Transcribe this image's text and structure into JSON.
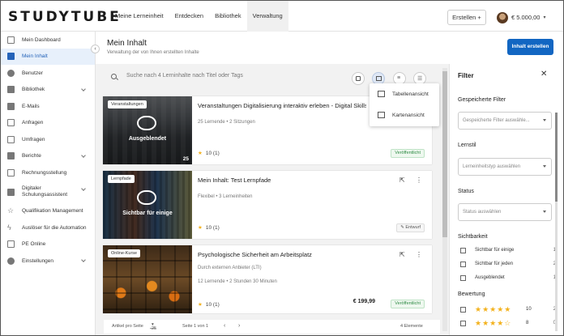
{
  "app": {
    "logo": "STUDYTUBE"
  },
  "topnav": {
    "items": [
      {
        "label": "Meine Lerneinheit",
        "active": false
      },
      {
        "label": "Entdecken",
        "active": false
      },
      {
        "label": "Bibliothek",
        "active": false
      },
      {
        "label": "Verwaltung",
        "active": true
      }
    ],
    "create_label": "Erstellen +",
    "balance": "€ 5.000,00"
  },
  "sidebar": {
    "items": [
      {
        "label": "Mein Dashboard",
        "icon": "dashboard-icon",
        "active": false,
        "expandable": false
      },
      {
        "label": "Mein Inhalt",
        "icon": "content-icon",
        "active": true,
        "expandable": false
      },
      {
        "label": "Benutzer",
        "icon": "user-icon",
        "active": false,
        "expandable": false
      },
      {
        "label": "Bibliothek",
        "icon": "library-icon",
        "active": false,
        "expandable": true
      },
      {
        "label": "E-Mails",
        "icon": "mail-icon",
        "active": false,
        "expandable": false
      },
      {
        "label": "Anfragen",
        "icon": "copy-icon",
        "active": false,
        "expandable": false
      },
      {
        "label": "Umfragen",
        "icon": "survey-icon",
        "active": false,
        "expandable": false
      },
      {
        "label": "Berichte",
        "icon": "report-icon",
        "active": false,
        "expandable": true
      },
      {
        "label": "Rechnungsstellung",
        "icon": "invoice-icon",
        "active": false,
        "expandable": false
      },
      {
        "label": "Digitaler Schulungsassistent",
        "icon": "assistant-icon",
        "active": false,
        "expandable": true
      },
      {
        "label": "Qualifikation Management",
        "icon": "star-icon",
        "active": false,
        "expandable": false
      },
      {
        "label": "Auslöser für die Automation",
        "icon": "bolt-icon",
        "active": false,
        "expandable": false
      },
      {
        "label": "PE Online",
        "icon": "pe-icon",
        "active": false,
        "expandable": false
      },
      {
        "label": "Einstellungen",
        "icon": "gear-icon",
        "active": false,
        "expandable": true
      }
    ]
  },
  "header": {
    "title": "Mein Inhalt",
    "subtitle": "Verwaltung der von Ihnen erstellten Inhalte",
    "primary_button": "Inhalt erstellen"
  },
  "search": {
    "placeholder": "Suche nach 4 Lerninhalte nach Titel oder Tags"
  },
  "view_menu": {
    "items": [
      "Tabellenansicht",
      "Kartenansicht"
    ]
  },
  "cards": [
    {
      "tag": "Veranstaltungen",
      "title": "Veranstaltungen Digitalisierung interaktiv erleben - Digital Skills Camp",
      "meta_lines": [
        "25 Lernende • 2 Sitzungen"
      ],
      "overlay": "Ausgeblendet",
      "count": "25",
      "rating": "10 (1)",
      "price": "",
      "status": "Veröffentlicht",
      "draft": false,
      "actions": false
    },
    {
      "tag": "Lernpfade",
      "title": "Mein Inhalt: Test Lernpfade",
      "meta_lines": [
        "Flexibel • 3 Lerneinheiten"
      ],
      "overlay": "Sichtbar für einige",
      "count": "",
      "rating": "10 (1)",
      "price": "",
      "status": "Entwurf",
      "draft": true,
      "actions": true
    },
    {
      "tag": "Online-Kurse",
      "title": "Psychologische Sicherheit am Arbeitsplatz",
      "meta_lines": [
        "Durch externen Anbieter (LTI)",
        "12 Lernende • 2 Stunden 30 Minuten"
      ],
      "overlay": "",
      "count": "",
      "rating": "10 (1)",
      "price": "€ 199,99",
      "status": "Veröffentlicht",
      "draft": false,
      "actions": true
    }
  ],
  "pager": {
    "per_page_label": "Artikel pro Seite",
    "per_page": "25",
    "page_info": "Seite 1 von 1",
    "total": "4 Elemente"
  },
  "filter": {
    "title": "Filter",
    "saved_label": "Gespeicherte Filter",
    "saved_placeholder": "Gespeicherte Filter auswähle...",
    "style_label": "Lernstil",
    "style_placeholder": "Lerneinheitstyp auswählen",
    "status_label": "Status",
    "status_placeholder": "Status auswählen",
    "visibility_label": "Sichtbarkeit",
    "visibility": [
      {
        "label": "Sichtbar für einige",
        "count": "1"
      },
      {
        "label": "Sichtbar für jeden",
        "count": "2"
      },
      {
        "label": "Ausgeblendet",
        "count": "1"
      }
    ],
    "rating_label": "Bewertung",
    "ratings": [
      {
        "stars": "★★★★★",
        "value": "10",
        "count": "2"
      },
      {
        "stars": "★★★★☆",
        "value": "8",
        "count": "0"
      }
    ]
  },
  "colors": {
    "primary": "#1266c2",
    "published": "#2e8b44",
    "star": "#f3b21e"
  }
}
